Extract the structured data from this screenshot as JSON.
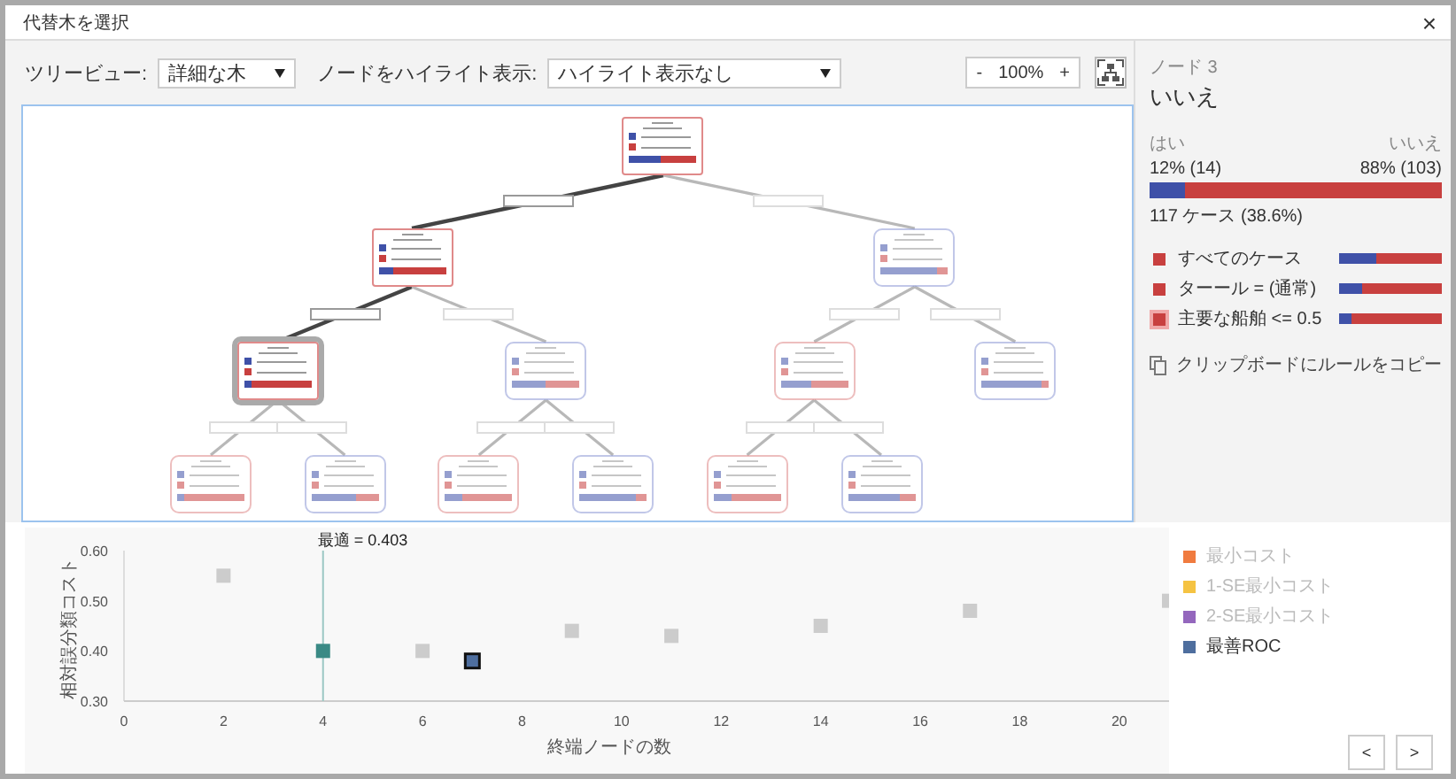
{
  "window": {
    "title": "代替木を選択",
    "close": "×"
  },
  "toolbar": {
    "tree_view_label": "ツリービュー:",
    "tree_view": "詳細な木",
    "highlight_label": "ノードをハイライト表示:",
    "highlight": "ハイライト表示なし",
    "zoom_out": "-",
    "zoom": "100%",
    "zoom_in": "+"
  },
  "tree": {
    "root": {
      "kind": "no",
      "level": 0.45,
      "dim": false,
      "selected": false,
      "children": [
        {
          "kind": "no",
          "level": 0.22,
          "dim": false,
          "selected": false,
          "on_path": true,
          "children": [
            {
              "kind": "no",
              "level": 0.12,
              "dim": false,
              "selected": true,
              "on_path": true,
              "children": [
                {
                  "kind": "no",
                  "level": 0.1,
                  "dim": true,
                  "selected": false,
                  "on_path": false
                },
                {
                  "kind": "yes",
                  "level": 0.66,
                  "dim": true,
                  "selected": false,
                  "on_path": false
                }
              ]
            },
            {
              "kind": "yes",
              "level": 0.5,
              "dim": true,
              "selected": false,
              "on_path": false,
              "children": [
                {
                  "kind": "no",
                  "level": 0.25,
                  "dim": true,
                  "selected": false,
                  "on_path": false
                },
                {
                  "kind": "yes",
                  "level": 0.85,
                  "dim": true,
                  "selected": false,
                  "on_path": false
                }
              ]
            }
          ]
        },
        {
          "kind": "yes",
          "level": 0.84,
          "dim": true,
          "selected": false,
          "on_path": false,
          "children": [
            {
              "kind": "no",
              "level": 0.45,
              "dim": true,
              "selected": false,
              "on_path": false,
              "children": [
                {
                  "kind": "no",
                  "level": 0.27,
                  "dim": true,
                  "selected": false,
                  "on_path": false
                },
                {
                  "kind": "yes",
                  "level": 0.78,
                  "dim": true,
                  "selected": false,
                  "on_path": false
                }
              ]
            },
            {
              "kind": "yes",
              "level": 0.9,
              "dim": true,
              "selected": false,
              "on_path": false
            }
          ]
        }
      ]
    }
  },
  "node_panel": {
    "title": "ノード 3",
    "class": "いいえ",
    "left_label": "はい",
    "right_label": "いいえ",
    "left_value": "12% (14)",
    "right_value": "88% (103)",
    "level": 0.12,
    "cases": "117 ケース (38.6%)",
    "rules": [
      {
        "label": "すべてのケース",
        "level": 0.36,
        "selected": false
      },
      {
        "label": "ターール = (通常)",
        "level": 0.22,
        "selected": false
      },
      {
        "label": "主要な船舶 <= 0.5",
        "level": 0.12,
        "selected": true
      }
    ],
    "copy_link": "クリップボードにルールをコピー"
  },
  "chart": {
    "chart_data": {
      "type": "scatter",
      "xlabel": "終端ノードの数",
      "ylabel": "相対誤分類コスト",
      "x": [
        2,
        4,
        6,
        7,
        9,
        11,
        14,
        17,
        21
      ],
      "series": [
        {
          "color": "#cccccc",
          "values": [
            0.55,
            null,
            0.4,
            null,
            0.44,
            0.43,
            0.45,
            0.48,
            0.5
          ]
        },
        {
          "color": "#3a8a85",
          "values": [
            null,
            0.4,
            null,
            null,
            null,
            null,
            null,
            null,
            null
          ]
        },
        {
          "color": "#4e6e9e",
          "values": [
            null,
            null,
            null,
            0.38,
            null,
            null,
            null,
            null,
            null
          ]
        }
      ],
      "xlim": [
        0,
        21
      ],
      "ylim": [
        0.3,
        0.6
      ],
      "xticks": [
        0,
        2,
        4,
        6,
        8,
        10,
        12,
        14,
        16,
        18,
        20
      ],
      "yticks": [
        {
          "value": 0.3,
          "label": "0.30"
        },
        {
          "value": 0.4,
          "label": "0.40"
        },
        {
          "value": 0.5,
          "label": "0.50"
        },
        {
          "value": 0.6,
          "label": "0.60"
        }
      ],
      "ref_lines": [
        {
          "axis": "x",
          "value": 4
        }
      ],
      "annotations": [
        "最適 = 0.403"
      ]
    },
    "legend": [
      {
        "label": "最小コスト",
        "color": "#f07b3f",
        "disabled": true
      },
      {
        "label": "1-SE最小コスト",
        "color": "#f5c342",
        "disabled": true
      },
      {
        "label": "2-SE最小コスト",
        "color": "#9467bd",
        "disabled": true
      },
      {
        "label": "最善ROC",
        "color": "#4e6e9e",
        "disabled": false
      }
    ]
  },
  "nav": [
    "<",
    ">"
  ]
}
